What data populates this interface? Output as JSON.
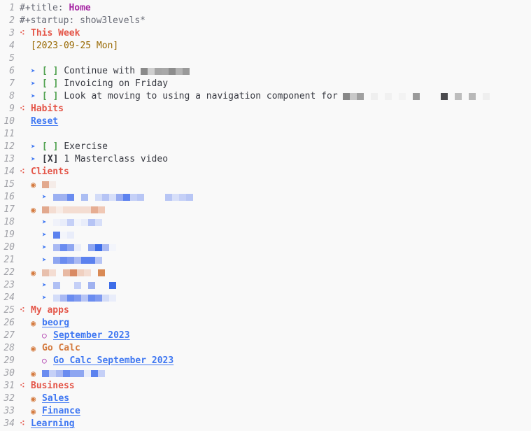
{
  "lines": {
    "l1": {
      "num": "1",
      "key": "#+title: ",
      "value": "Home"
    },
    "l2": {
      "num": "2",
      "key": "#+startup: ",
      "value": "show3levels*"
    },
    "l3": {
      "num": "3",
      "bullet": "⁖",
      "heading": "This Week"
    },
    "l4": {
      "num": "4",
      "timestamp": "[2023-09-25 Mon]"
    },
    "l5": {
      "num": "5"
    },
    "l6": {
      "num": "6",
      "checkbox": "[ ]",
      "text": "Continue with "
    },
    "l7": {
      "num": "7",
      "checkbox": "[ ]",
      "text": "Invoicing on Friday"
    },
    "l8": {
      "num": "8",
      "checkbox": "[ ]",
      "text": "Look at moving to using a navigation component for "
    },
    "l9": {
      "num": "9",
      "bullet": "⁖",
      "heading": "Habits"
    },
    "l10": {
      "num": "10",
      "link": "Reset"
    },
    "l11": {
      "num": "11"
    },
    "l12": {
      "num": "12",
      "checkbox": "[ ]",
      "text": "Exercise"
    },
    "l13": {
      "num": "13",
      "checkbox": "[X]",
      "text": "1 Masterclass video"
    },
    "l14": {
      "num": "14",
      "bullet": "⁖",
      "heading": "Clients"
    },
    "l15": {
      "num": "15"
    },
    "l16": {
      "num": "16"
    },
    "l17": {
      "num": "17"
    },
    "l18": {
      "num": "18"
    },
    "l19": {
      "num": "19"
    },
    "l20": {
      "num": "20"
    },
    "l21": {
      "num": "21"
    },
    "l22": {
      "num": "22"
    },
    "l23": {
      "num": "23"
    },
    "l24": {
      "num": "24"
    },
    "l25": {
      "num": "25",
      "bullet": "⁖",
      "heading": "My apps"
    },
    "l26": {
      "num": "26",
      "link": "beorg"
    },
    "l27": {
      "num": "27",
      "link": "September 2023"
    },
    "l28": {
      "num": "28",
      "heading": "Go Calc"
    },
    "l29": {
      "num": "29",
      "link": "Go Calc September 2023"
    },
    "l30": {
      "num": "30"
    },
    "l31": {
      "num": "31",
      "bullet": "⁖",
      "heading": "Business"
    },
    "l32": {
      "num": "32",
      "link": "Sales"
    },
    "l33": {
      "num": "33",
      "link": "Finance"
    },
    "l34": {
      "num": "34",
      "bullet": "⁖",
      "link": "Learning"
    }
  },
  "glyphs": {
    "arrow": "➤",
    "level2_bullet": "◉",
    "level3_bullet": "○"
  },
  "colors": {
    "heading1": "#e45649",
    "heading2": "#d47a3e",
    "link": "#4078f2",
    "checkbox_open": "#50a14f",
    "title": "#a626a4",
    "timestamp": "#986801"
  }
}
